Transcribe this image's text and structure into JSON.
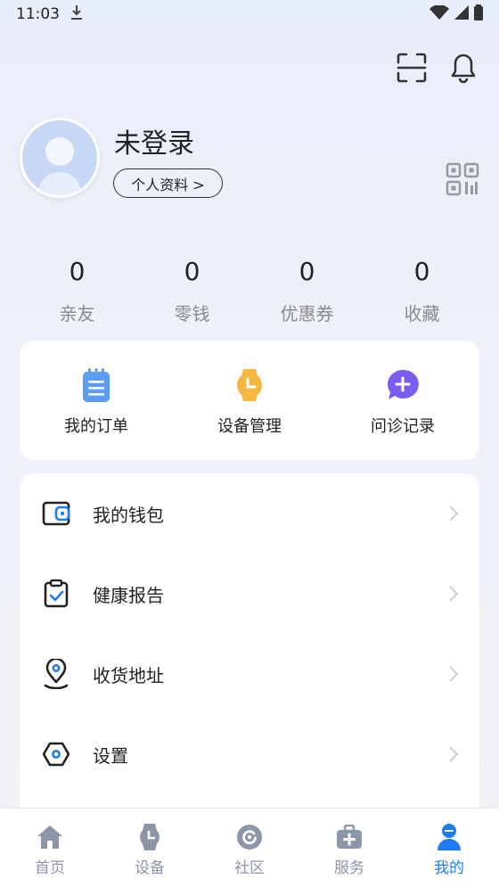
{
  "status_bar": {
    "time": "11:03"
  },
  "profile": {
    "username": "未登录",
    "profile_button": "个人资料 >"
  },
  "stats": [
    {
      "value": "0",
      "label": "亲友"
    },
    {
      "value": "0",
      "label": "零钱"
    },
    {
      "value": "0",
      "label": "优惠券"
    },
    {
      "value": "0",
      "label": "收藏"
    }
  ],
  "quick_actions": [
    {
      "label": "我的订单",
      "icon": "order-icon",
      "color": "#5b9cf5"
    },
    {
      "label": "设备管理",
      "icon": "watch-icon",
      "color": "#f5b740"
    },
    {
      "label": "问诊记录",
      "icon": "chat-plus-icon",
      "color": "#7a5cf0"
    }
  ],
  "menu": [
    {
      "label": "我的钱包",
      "icon": "wallet-icon"
    },
    {
      "label": "健康报告",
      "icon": "clipboard-check-icon"
    },
    {
      "label": "收货地址",
      "icon": "location-icon"
    },
    {
      "label": "设置",
      "icon": "settings-icon"
    }
  ],
  "bottom_nav": [
    {
      "label": "首页",
      "icon": "home-icon",
      "active": false
    },
    {
      "label": "设备",
      "icon": "watch-icon",
      "active": false
    },
    {
      "label": "社区",
      "icon": "community-icon",
      "active": false
    },
    {
      "label": "服务",
      "icon": "medical-kit-icon",
      "active": false
    },
    {
      "label": "我的",
      "icon": "user-icon",
      "active": true
    }
  ],
  "colors": {
    "accent": "#1f7cf5",
    "inactive_nav": "#8c96a8"
  }
}
